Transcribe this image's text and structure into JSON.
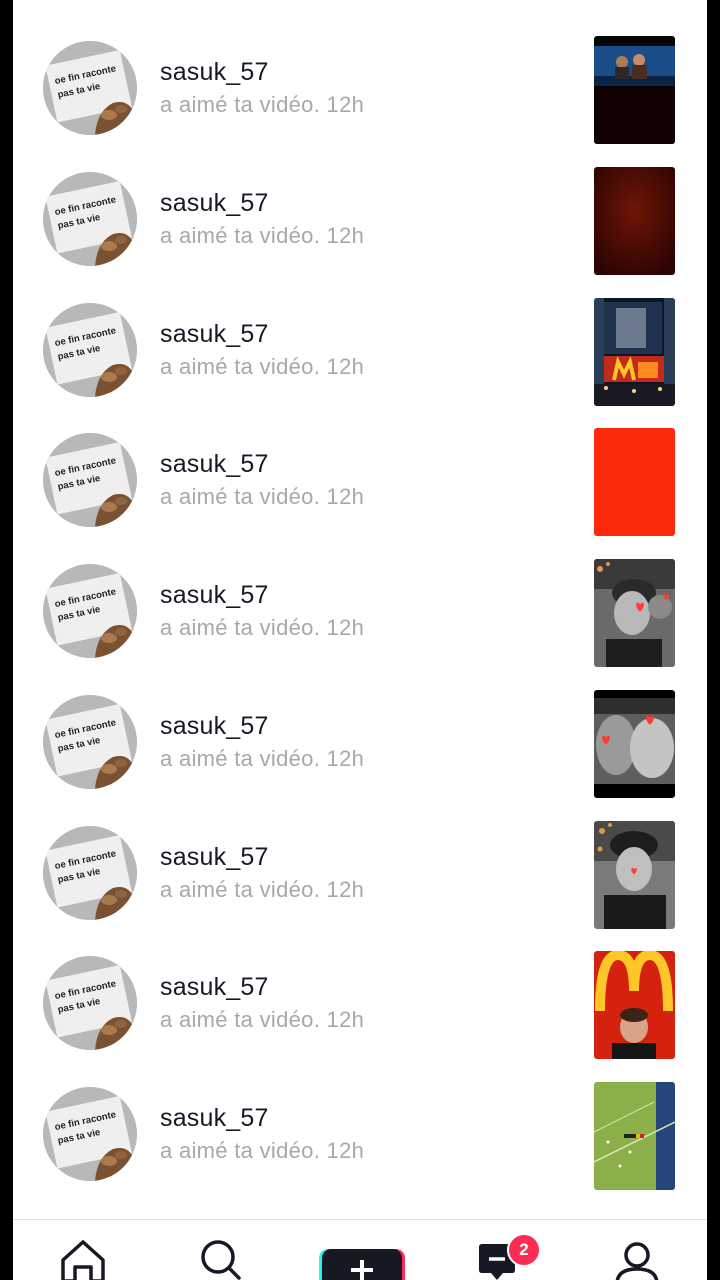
{
  "notifications": [
    {
      "username": "sasuk_57",
      "action": "a aimé ta vidéo.",
      "time": "12h",
      "thumb": "movie-scene"
    },
    {
      "username": "sasuk_57",
      "action": "a aimé ta vidéo.",
      "time": "12h",
      "thumb": "dark-red"
    },
    {
      "username": "sasuk_57",
      "action": "a aimé ta vidéo.",
      "time": "12h",
      "thumb": "mcdonalds-building"
    },
    {
      "username": "sasuk_57",
      "action": "a aimé ta vidéo.",
      "time": "12h",
      "thumb": "red"
    },
    {
      "username": "sasuk_57",
      "action": "a aimé ta vidéo.",
      "time": "12h",
      "thumb": "bw-hearts-selfie"
    },
    {
      "username": "sasuk_57",
      "action": "a aimé ta vidéo.",
      "time": "12h",
      "thumb": "bw-hearts-couple"
    },
    {
      "username": "sasuk_57",
      "action": "a aimé ta vidéo.",
      "time": "12h",
      "thumb": "bw-selfie"
    },
    {
      "username": "sasuk_57",
      "action": "a aimé ta vidéo.",
      "time": "12h",
      "thumb": "mcdonalds-selfie"
    },
    {
      "username": "sasuk_57",
      "action": "a aimé ta vidéo.",
      "time": "12h",
      "thumb": "football-pitch"
    }
  ],
  "avatar_text": [
    "oe fin raconte",
    "pas ta vie"
  ],
  "bottom_nav": {
    "items": [
      "home-icon",
      "search-icon",
      "create-icon",
      "inbox-icon",
      "profile-icon"
    ],
    "inbox_badge": "2"
  },
  "colors": {
    "accent_pink": "#fe2c55",
    "accent_cyan": "#25f4ee",
    "text_primary": "#161823",
    "text_secondary": "#a7a8ab"
  }
}
